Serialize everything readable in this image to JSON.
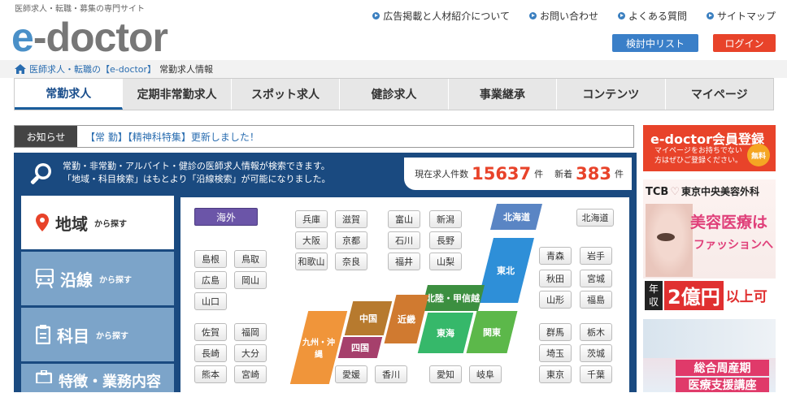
{
  "header": {
    "tagline": "医師求人・転職・募集の専門サイト",
    "logo_e": "e",
    "logo_rest": "-doctor",
    "links": [
      "広告掲載と人材紹介について",
      "お問い合わせ",
      "よくある質問",
      "サイトマップ"
    ],
    "list_button": "検討中リスト",
    "login_button": "ログイン"
  },
  "breadcrumb": {
    "home_link": "医師求人・転職の【e-doctor】",
    "current": "常勤求人情報"
  },
  "nav": {
    "tabs": [
      "常勤求人",
      "定期非常勤求人",
      "スポット求人",
      "健診求人",
      "事業継承",
      "コンテンツ",
      "マイページ"
    ]
  },
  "news": {
    "label": "お知らせ",
    "text": "【常 勤】【精神科特集】更新しました！"
  },
  "search": {
    "line1": "常勤・非常勤・アルバイト・健診の医師求人情報が検索できます。",
    "line2": "「地域・科目検索」はもとより「沿線検索」が可能になりました。",
    "count_label": "現在求人件数",
    "count_value": "15637",
    "count_unit": "件",
    "new_label": "新着",
    "new_value": "383",
    "new_unit": "件",
    "side": [
      {
        "title": "地域",
        "sub": "から探す"
      },
      {
        "title": "沿線",
        "sub": "から探す"
      },
      {
        "title": "科目",
        "sub": "から探す"
      },
      {
        "title": "特徴・業務内容",
        "sub": ""
      }
    ],
    "overseas": "海外",
    "regions": {
      "hokkaido": "北海道",
      "tohoku": "東北",
      "kanto": "関東",
      "hokuriku": "北陸・甲信越",
      "tokai": "東海",
      "kinki": "近畿",
      "chugoku": "中国",
      "shikoku": "四国",
      "kyushu": "九州・沖縄"
    },
    "prefs": {
      "hokkaido": "北海道",
      "tohoku": [
        "青森",
        "岩手",
        "秋田",
        "宮城",
        "山形",
        "福島"
      ],
      "kanto": [
        "群馬",
        "栃木",
        "埼玉",
        "茨城",
        "東京",
        "千葉"
      ],
      "kinki": [
        "兵庫",
        "滋賀",
        "大阪",
        "京都",
        "和歌山",
        "奈良"
      ],
      "hokuriku": [
        "富山",
        "新潟",
        "石川",
        "長野",
        "福井",
        "山梨"
      ],
      "chugoku": [
        "島根",
        "鳥取",
        "広島",
        "岡山",
        "山口"
      ],
      "kyushu": [
        "佐賀",
        "福岡",
        "長崎",
        "大分",
        "熊本",
        "宮崎"
      ],
      "shikoku": [
        "愛媛",
        "香川"
      ],
      "tokai": [
        "愛知",
        "岐阜"
      ]
    }
  },
  "sidebar": {
    "member_title": "e-doctor会員登録",
    "member_sub1": "マイページをお持ちでない",
    "member_sub2": "方はぜひご登録ください。",
    "member_badge": "無料",
    "ad1_brand": "TCB",
    "ad1_clinic": "東京中央美容外科",
    "ad1_line1": "美容医療は",
    "ad1_line2": "ファッションへ",
    "ad1_nen": "年",
    "ad1_shu": "収",
    "ad1_amount": "2億円",
    "ad1_suffix": "以上可",
    "ad2_line1": "総合周産期",
    "ad2_line2": "医療支援講座"
  },
  "colors": {
    "brand_blue": "#4a90c8",
    "login_red": "#e8432a",
    "panel_blue": "#1a4a80"
  }
}
